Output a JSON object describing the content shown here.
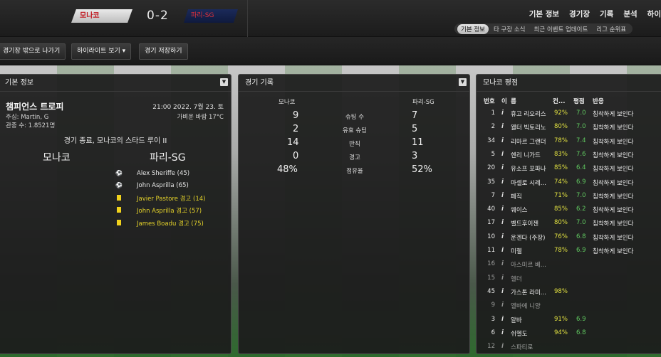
{
  "header": {
    "home_team": "모나코",
    "score": "0-2",
    "away_team": "파리-SG",
    "nav": [
      "기본 정보",
      "경기장",
      "기록",
      "분석",
      "하이"
    ],
    "subnav": [
      "기본 정보",
      "타 구장 소식",
      "최근 이벤트 업데이트",
      "리그 순위표"
    ]
  },
  "toolbar": {
    "leave": "경기장 밖으로 나가기",
    "highlights": "하이라이트 보기 ▾",
    "save": "경기 저장하기"
  },
  "info": {
    "title": "기본 정보",
    "competition": "챔피언스 트로피",
    "datetime": "21:00 2022. 7월 23. 토",
    "referee": "주심: Martin, G",
    "weather": "가벼운 바람 17°C",
    "attendance": "관중 수: 1.8521명",
    "result": "경기 종료, 모나코의 스타드 루이 II",
    "home": "모나코",
    "away": "파리-SG",
    "events": [
      {
        "type": "goal",
        "text": "Alex Sheriffe (45)"
      },
      {
        "type": "goal",
        "text": "John Asprilla (65)"
      },
      {
        "type": "card",
        "text": "Javier Pastore 경고 (14)"
      },
      {
        "type": "card",
        "text": "John Asprilla 경고 (57)"
      },
      {
        "type": "card",
        "text": "James Boadu 경고 (75)"
      }
    ]
  },
  "stats": {
    "title": "경기 기록",
    "home": "모나코",
    "away": "파리-SG",
    "rows": [
      {
        "label": "슈팅 수",
        "home": "9",
        "away": "7"
      },
      {
        "label": "유효 슈팅",
        "home": "2",
        "away": "5"
      },
      {
        "label": "반칙",
        "home": "14",
        "away": "11"
      },
      {
        "label": "경고",
        "home": "0",
        "away": "3"
      },
      {
        "label": "점유율",
        "home": "48%",
        "away": "52%"
      }
    ]
  },
  "ratings": {
    "title": "모나코 평점",
    "cols": {
      "no": "번호",
      "info": "이",
      "name": "름",
      "pct": "컨...",
      "rating": "평점",
      "reaction": "반응"
    },
    "rows": [
      {
        "no": "1",
        "i": "i",
        "name": "휴고 리오리스",
        "pct": "92%",
        "rating": "7.0",
        "reaction": "침착하게 보인다"
      },
      {
        "no": "2",
        "i": "i",
        "name": "웰터 빅토리노",
        "pct": "80%",
        "rating": "7.0",
        "reaction": "침착하게 보인다"
      },
      {
        "no": "34",
        "i": "i",
        "name": "리마르 그랜더",
        "pct": "78%",
        "rating": "7.4",
        "reaction": "침착하게 보인다"
      },
      {
        "no": "5",
        "i": "i",
        "name": "헨리 니가드",
        "pct": "83%",
        "rating": "7.6",
        "reaction": "침착하게 보인다"
      },
      {
        "no": "20",
        "i": "i",
        "name": "유소프 포파나",
        "pct": "85%",
        "rating": "6.4",
        "reaction": "침착하게 보인다"
      },
      {
        "no": "35",
        "i": "i",
        "name": "마셀로 시레...",
        "pct": "74%",
        "rating": "6.9",
        "reaction": "침착하게 보인다"
      },
      {
        "no": "7",
        "i": "i",
        "name": "페직",
        "pct": "71%",
        "rating": "7.0",
        "reaction": "침착하게 보인다"
      },
      {
        "no": "40",
        "i": "i",
        "name": "웨이스",
        "pct": "85%",
        "rating": "6.2",
        "reaction": "침착하게 보인다"
      },
      {
        "no": "17",
        "i": "i",
        "name": "벨드후이젠",
        "pct": "80%",
        "rating": "7.0",
        "reaction": "침착하게 보인다"
      },
      {
        "no": "10",
        "i": "i",
        "name": "운겐다 (주장)",
        "pct": "76%",
        "rating": "6.8",
        "reaction": "침착하게 보인다"
      },
      {
        "no": "11",
        "i": "i",
        "name": "미첼",
        "pct": "78%",
        "rating": "6.9",
        "reaction": "침착하게 보인다"
      },
      {
        "no": "16",
        "i": "i",
        "name": "아스미르 베...",
        "pct": "",
        "rating": "",
        "reaction": "",
        "faded": true
      },
      {
        "no": "15",
        "i": "i",
        "name": "헬더",
        "pct": "",
        "rating": "",
        "reaction": "",
        "faded": true
      },
      {
        "no": "45",
        "i": "i",
        "name": "가스톤 라미...",
        "pct": "98%",
        "rating": "",
        "reaction": ""
      },
      {
        "no": "9",
        "i": "i",
        "name": "엘바에 니양",
        "pct": "",
        "rating": "",
        "reaction": "",
        "faded": true
      },
      {
        "no": "3",
        "i": "i",
        "name": "알바",
        "pct": "91%",
        "rating": "6.9",
        "reaction": ""
      },
      {
        "no": "6",
        "i": "i",
        "name": "쉬헬도",
        "pct": "94%",
        "rating": "6.8",
        "reaction": ""
      },
      {
        "no": "12",
        "i": "i",
        "name": "스파티로",
        "pct": "",
        "rating": "",
        "reaction": "",
        "faded": true
      }
    ]
  }
}
